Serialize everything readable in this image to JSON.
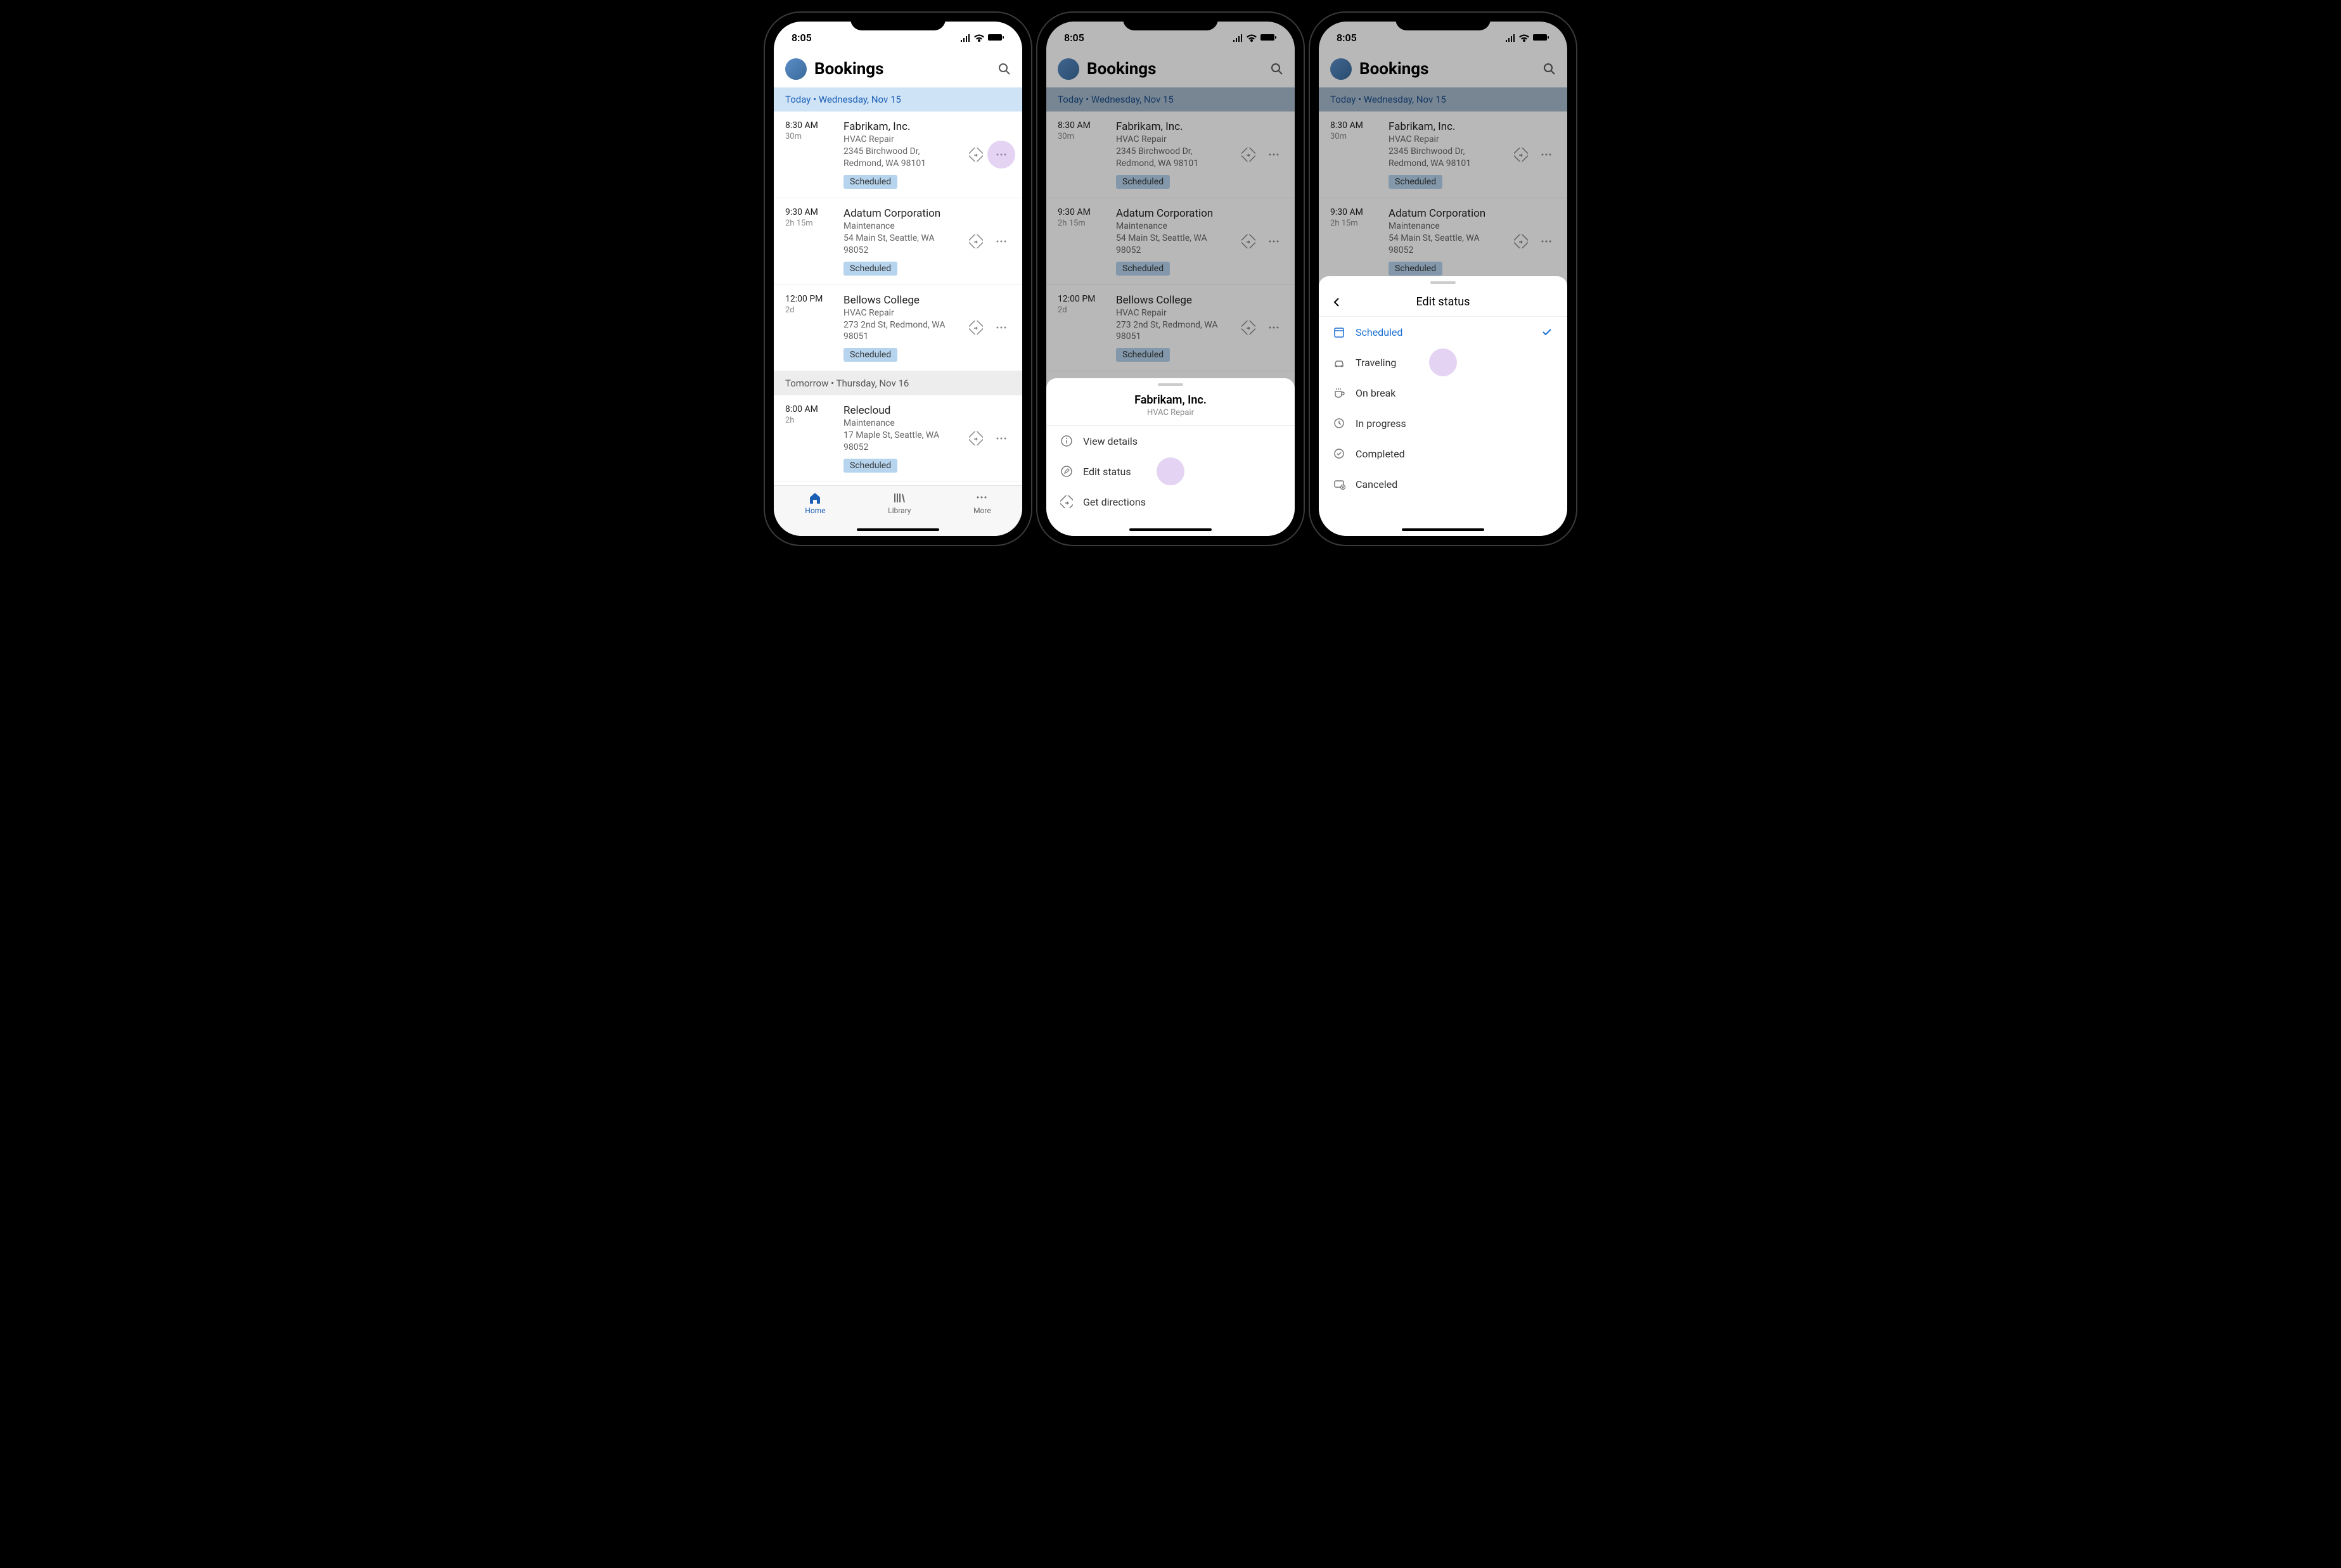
{
  "statusBar": {
    "time": "8:05"
  },
  "header": {
    "title": "Bookings"
  },
  "dateBanner": "Today • Wednesday, Nov 15",
  "dateBanner2": "Tomorrow • Thursday, Nov 16",
  "bookings": [
    {
      "time": "8:30 AM",
      "duration": "30m",
      "title": "Fabrikam, Inc.",
      "type": "HVAC Repair",
      "addr": "2345 Birchwood Dr, Redmond, WA 98101",
      "status": "Scheduled"
    },
    {
      "time": "9:30 AM",
      "duration": "2h 15m",
      "title": "Adatum Corporation",
      "type": "Maintenance",
      "addr": "54 Main St, Seattle, WA 98052",
      "status": "Scheduled"
    },
    {
      "time": "12:00 PM",
      "duration": "2d",
      "title": "Bellows College",
      "type": "HVAC Repair",
      "addr": "273 2nd St, Redmond, WA 98051",
      "status": "Scheduled"
    },
    {
      "time": "8:00 AM",
      "duration": "2h",
      "title": "Relecloud",
      "type": "Maintenance",
      "addr": "17 Maple St, Seattle, WA 98052",
      "status": "Scheduled"
    }
  ],
  "nav": {
    "home": "Home",
    "library": "Library",
    "more": "More"
  },
  "sheet1": {
    "title": "Fabrikam, Inc.",
    "sub": "HVAC Repair",
    "items": {
      "view": "View details",
      "edit": "Edit status",
      "directions": "Get directions"
    }
  },
  "sheet2": {
    "title": "Edit status",
    "options": {
      "scheduled": "Scheduled",
      "traveling": "Traveling",
      "onbreak": "On break",
      "inprogress": "In progress",
      "completed": "Completed",
      "canceled": "Canceled"
    }
  }
}
